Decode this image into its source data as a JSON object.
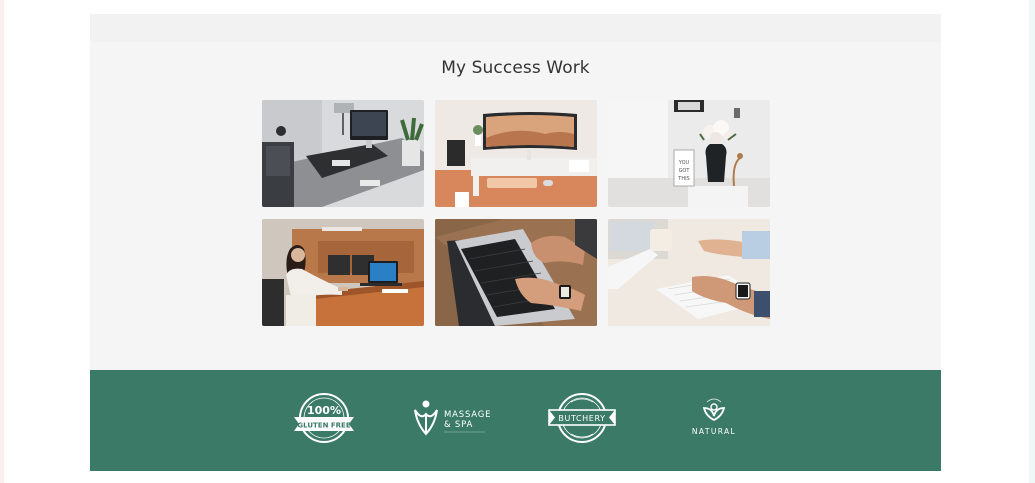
{
  "section": {
    "title": "My Success Work"
  },
  "gallery": [
    {
      "name": "imac-desk-photo",
      "icon": "photo-imac-desk"
    },
    {
      "name": "curved-monitor-desk-photo",
      "icon": "photo-curved-monitor"
    },
    {
      "name": "flower-vase-frame-photo",
      "icon": "photo-flower-vase"
    },
    {
      "name": "woman-laptop-office-photo",
      "icon": "photo-woman-office"
    },
    {
      "name": "laptop-typing-photo",
      "icon": "photo-laptop-typing"
    },
    {
      "name": "keyboard-typing-photo",
      "icon": "photo-keyboard-typing"
    }
  ],
  "logos": {
    "gluten_free": {
      "top": "100%",
      "bottom": "GLUTEN FREE"
    },
    "massage_spa": {
      "line1": "MASSAGE",
      "line2": "& SPA"
    },
    "butchery": {
      "label": "BUTCHERY"
    },
    "natural": {
      "label": "NATURAL"
    }
  },
  "colors": {
    "page_bg": "#f5f5f5",
    "band_bg": "#3b7a67",
    "title_text": "#333333"
  }
}
